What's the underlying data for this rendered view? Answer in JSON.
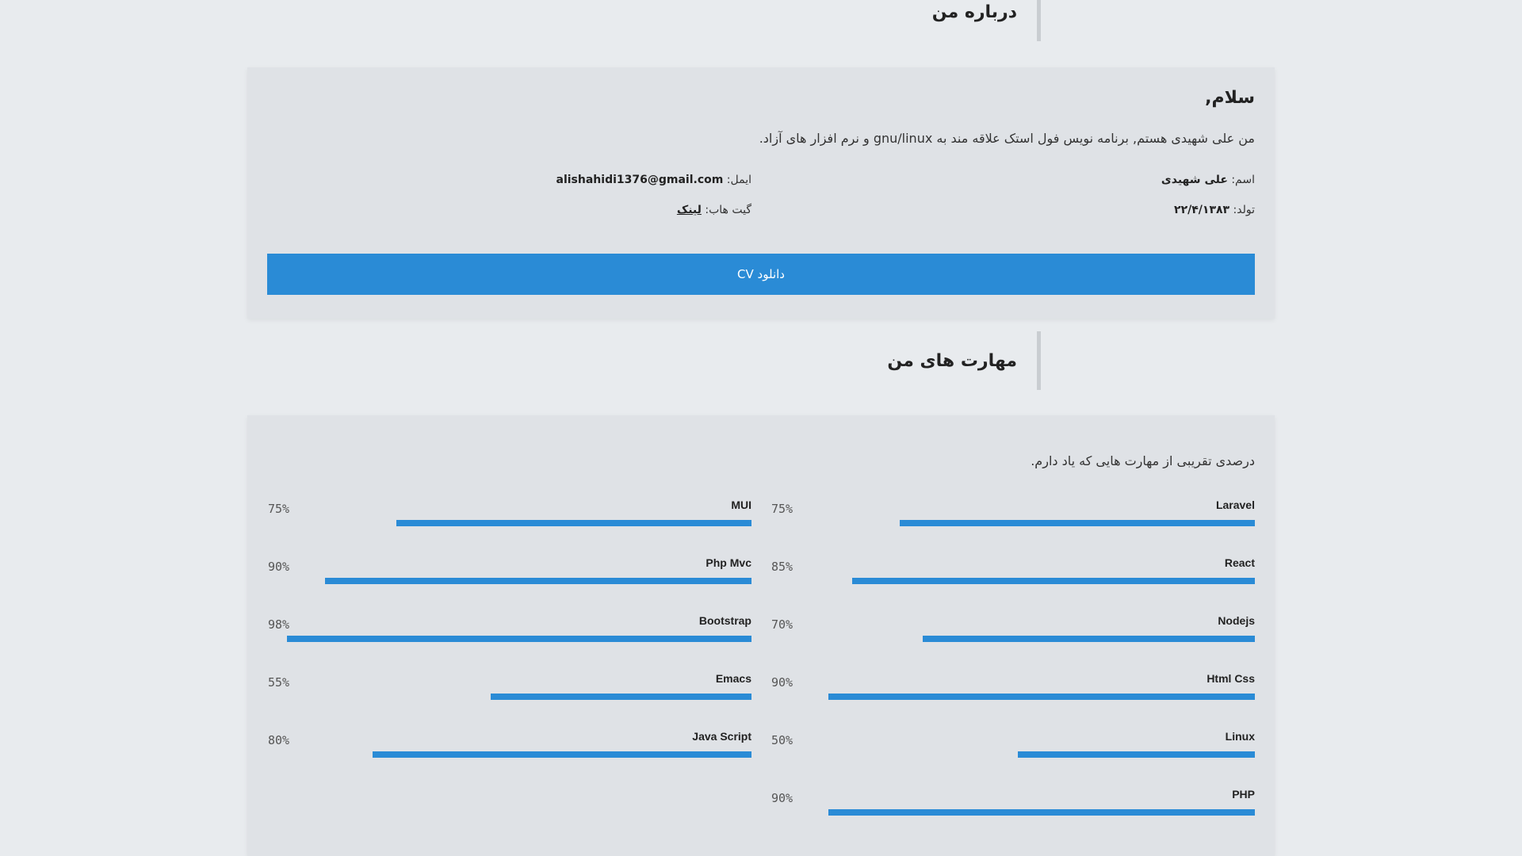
{
  "about": {
    "section_title": "درباره من",
    "greeting": "سلام,",
    "intro": "من علی شهیدی هستم, برنامه نویس فول استک علاقه مند به gnu/linux و نرم افزار های آزاد.",
    "name_label": "اسم:",
    "name_value": "علی شهیدی",
    "birth_label": "تولد:",
    "birth_value": "۲۲/۴/۱۳۸۳",
    "email_label": "ایمل:",
    "email_value": "alishahidi1376@gmail.com",
    "github_label": "گیت هاب:",
    "github_link": "لینک",
    "cv_button": "دانلود CV"
  },
  "skills": {
    "section_title": "مهارت های من",
    "description": "درصدی تقریبی از مهارت هایی که یاد دارم.",
    "right_column": [
      {
        "name": "Laravel",
        "percent_label": "75%",
        "level": 0.75
      },
      {
        "name": "React",
        "percent_label": "85%",
        "level": 0.85
      },
      {
        "name": "Nodejs",
        "percent_label": "70%",
        "level": 0.7
      },
      {
        "name": "Html Css",
        "percent_label": "90%",
        "level": 0.9
      },
      {
        "name": "Linux",
        "percent_label": "50%",
        "level": 0.5
      },
      {
        "name": "PHP",
        "percent_label": "90%",
        "level": 0.9
      }
    ],
    "left_column": [
      {
        "name": "MUI",
        "percent_label": "75%",
        "level": 0.75
      },
      {
        "name": "Php Mvc",
        "percent_label": "90%",
        "level": 0.9
      },
      {
        "name": "Bootstrap",
        "percent_label": "98%",
        "level": 0.98
      },
      {
        "name": "Emacs",
        "percent_label": "55%",
        "level": 0.55
      },
      {
        "name": "Java Script",
        "percent_label": "80%",
        "level": 0.8
      }
    ],
    "bar_color": "#2a8bd6"
  }
}
